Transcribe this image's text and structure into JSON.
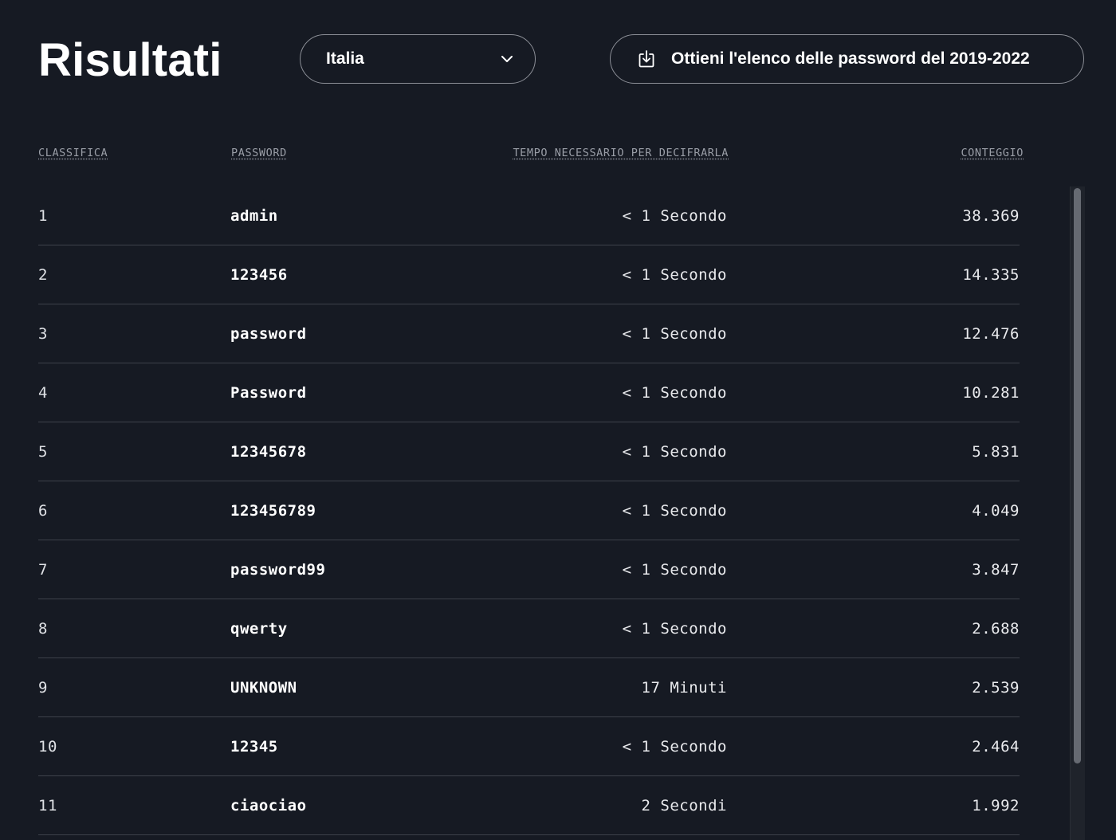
{
  "header": {
    "title": "Risultati",
    "country_select": {
      "value": "Italia",
      "icon": "chevron-down-icon"
    },
    "download_button": {
      "label": "Ottieni l'elenco delle password del 2019-2022",
      "icon": "download-icon"
    }
  },
  "table": {
    "columns": {
      "rank": "CLASSIFICA",
      "password": "PASSWORD",
      "time": "TEMPO NECESSARIO PER DECIFRARLA",
      "count": "CONTEGGIO"
    },
    "rows": [
      {
        "rank": "1",
        "password": "admin",
        "time": "< 1 Secondo",
        "count": "38.369"
      },
      {
        "rank": "2",
        "password": "123456",
        "time": "< 1 Secondo",
        "count": "14.335"
      },
      {
        "rank": "3",
        "password": "password",
        "time": "< 1 Secondo",
        "count": "12.476"
      },
      {
        "rank": "4",
        "password": "Password",
        "time": "< 1 Secondo",
        "count": "10.281"
      },
      {
        "rank": "5",
        "password": "12345678",
        "time": "< 1 Secondo",
        "count": "5.831"
      },
      {
        "rank": "6",
        "password": "123456789",
        "time": "< 1 Secondo",
        "count": "4.049"
      },
      {
        "rank": "7",
        "password": "password99",
        "time": "< 1 Secondo",
        "count": "3.847"
      },
      {
        "rank": "8",
        "password": "qwerty",
        "time": "< 1 Secondo",
        "count": "2.688"
      },
      {
        "rank": "9",
        "password": "UNKNOWN",
        "time": "17 Minuti",
        "count": "2.539"
      },
      {
        "rank": "10",
        "password": "12345",
        "time": "< 1 Secondo",
        "count": "2.464"
      },
      {
        "rank": "11",
        "password": "ciaociao",
        "time": "2 Secondi",
        "count": "1.992"
      }
    ]
  },
  "colors": {
    "background": "#161a23",
    "text": "#ffffff",
    "muted": "#9a9ea7",
    "border": "#8c8f97",
    "divider": "#3d414a"
  }
}
